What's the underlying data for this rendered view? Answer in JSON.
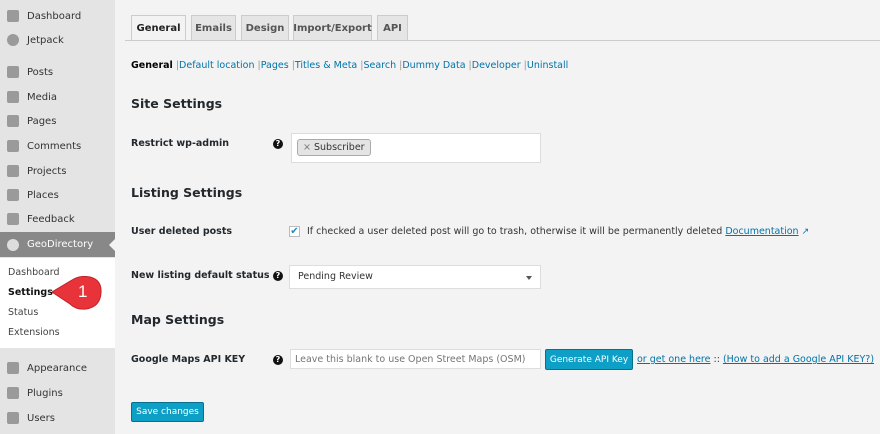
{
  "sidebar": {
    "items": [
      "Dashboard",
      "Jetpack",
      "Posts",
      "Media",
      "Pages",
      "Comments",
      "Projects",
      "Places",
      "Feedback",
      "GeoDirectory",
      "Appearance",
      "Plugins",
      "Users"
    ],
    "submenu": [
      "Dashboard",
      "Settings",
      "Status",
      "Extensions"
    ]
  },
  "callout": {
    "number": "1",
    "color": "#e8333a"
  },
  "tabs": [
    "General",
    "Emails",
    "Design",
    "Import/Export",
    "API"
  ],
  "subnav": {
    "current": "General",
    "links": [
      "Default location",
      "Pages",
      "Titles & Meta",
      "Search",
      "Dummy Data",
      "Developer",
      "Uninstall"
    ]
  },
  "site_settings": {
    "heading": "Site Settings",
    "restrict_label": "Restrict wp-admin",
    "chip": "Subscriber",
    "chip_remove": "×"
  },
  "listing_settings": {
    "heading": "Listing Settings",
    "deleted_label": "User deleted posts",
    "deleted_checked": true,
    "deleted_desc": "If checked a user deleted post will go to trash, otherwise it will be permanently deleted",
    "doc_link": "Documentation",
    "status_label": "New listing default status",
    "status_value": "Pending Review"
  },
  "map_settings": {
    "heading": "Map Settings",
    "api_label": "Google Maps API KEY",
    "api_placeholder": "Leave this blank to use Open Street Maps (OSM)",
    "generate_button": "Generate API Key",
    "get_one": "or get one here",
    "sep": "::",
    "how_to": "(How to add a Google API KEY?)"
  },
  "save_button": "Save changes",
  "help_glyph": "?"
}
